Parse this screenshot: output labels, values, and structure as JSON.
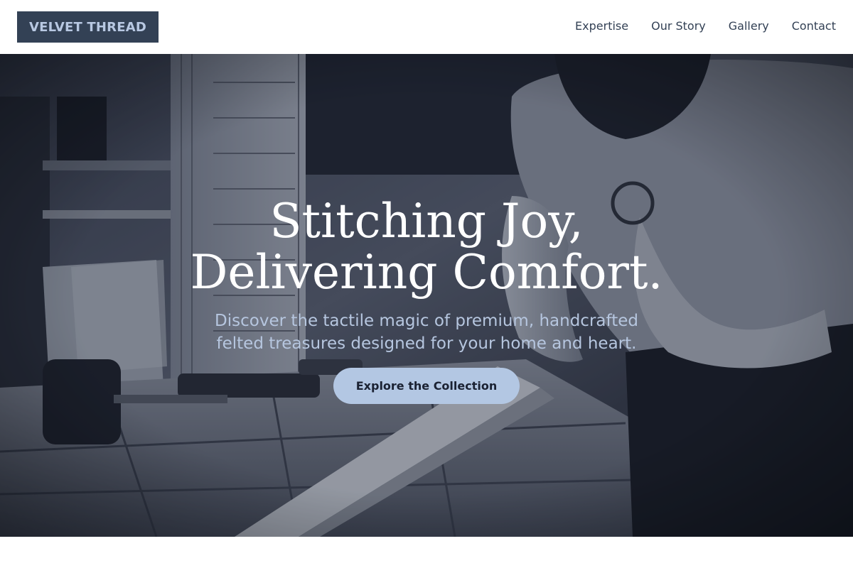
{
  "header": {
    "logo_text": "VELVET THREAD",
    "nav": [
      {
        "label": "Expertise"
      },
      {
        "label": "Our Story"
      },
      {
        "label": "Gallery"
      },
      {
        "label": "Contact"
      }
    ]
  },
  "hero": {
    "title_line1": "Stitching Joy,",
    "title_line2": "Delivering Comfort.",
    "subtitle_line1": "Discover the tactile magic of premium, handcrafted",
    "subtitle_line2": "felted treasures designed for your home and heart.",
    "cta_label": "Explore the Collection",
    "image_description_icon": "workshop-photo"
  },
  "colors": {
    "logo_bg": "#334155",
    "logo_text": "#b8c8e2",
    "nav_text": "#334155",
    "cta_bg": "#b3c7e3",
    "cta_text": "#1b2233",
    "hero_title": "#ffffff",
    "hero_subtitle": "#b6c6df"
  }
}
